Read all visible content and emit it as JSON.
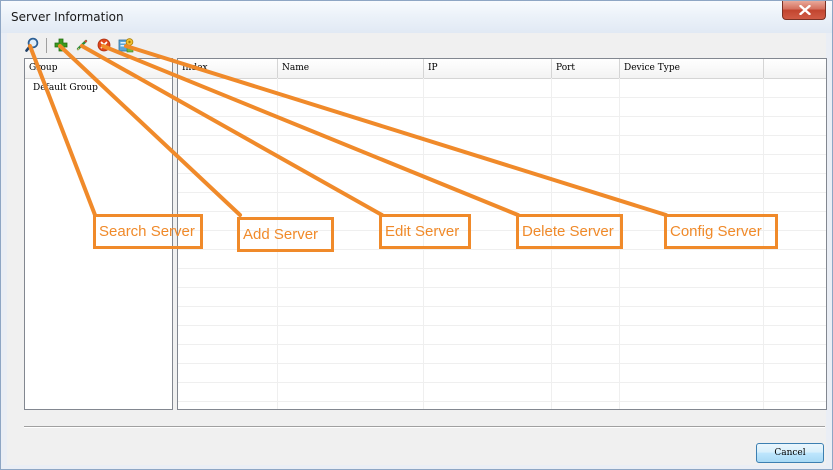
{
  "window": {
    "title": "Server Information",
    "close_glyph": "x"
  },
  "toolbar": {
    "buttons": [
      {
        "name": "search-server",
        "icon": "magnifier-icon"
      },
      {
        "name": "add-server",
        "icon": "plus-icon"
      },
      {
        "name": "edit-server",
        "icon": "pencil-icon"
      },
      {
        "name": "delete-server",
        "icon": "delete-icon"
      },
      {
        "name": "config-server",
        "icon": "config-icon"
      }
    ]
  },
  "group_panel": {
    "header": "Group",
    "items": [
      "Default Group"
    ]
  },
  "server_table": {
    "columns": [
      "Index",
      "Name",
      "IP",
      "Port",
      "Device Type"
    ],
    "rows": []
  },
  "footer": {
    "cancel_label": "Cancel"
  },
  "annotations": {
    "color": "#f08a2a",
    "labels": [
      "Search Server",
      "Add Server",
      "Edit Server",
      "Delete Server",
      "Config  Server"
    ]
  },
  "colors": {
    "close_button": "#c2452f",
    "add_icon": "#3a9a1e",
    "delete_icon": "#e0461c",
    "edit_icon": "#2e8b3a"
  }
}
